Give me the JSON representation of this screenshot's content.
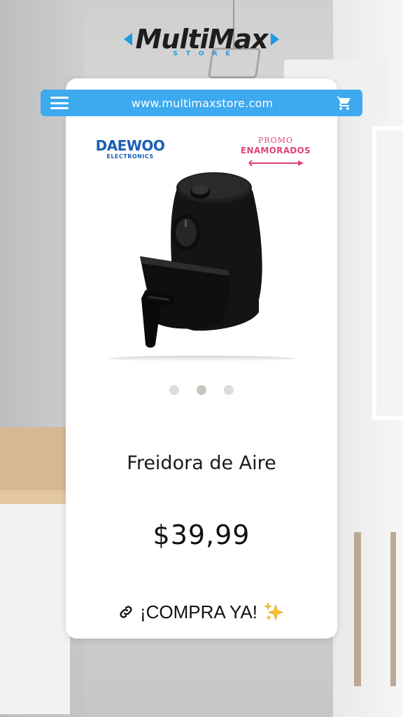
{
  "logo": {
    "name": "MultiMax",
    "subtitle": "STORE"
  },
  "urlbar": {
    "menu_icon": "hamburger-menu-icon",
    "url": "www.multimaxstore.com",
    "cart_icon": "shopping-cart-icon",
    "bg_color": "#3da9ef"
  },
  "brand": {
    "name": "DAEWOO",
    "sub": "ELECTRONICS",
    "color": "#1b5fb5"
  },
  "promo": {
    "top": "PROMO",
    "main": "ENAMORADOS",
    "color": "#e0457a"
  },
  "product": {
    "image": "air-fryer",
    "name": "Freidora de Aire",
    "price": "$39,99"
  },
  "carousel": {
    "count": 3,
    "active": 2
  },
  "cta": {
    "label": "¡COMPRA YA!",
    "left_icon": "link-icon",
    "right_icon": "sparkles-icon"
  }
}
